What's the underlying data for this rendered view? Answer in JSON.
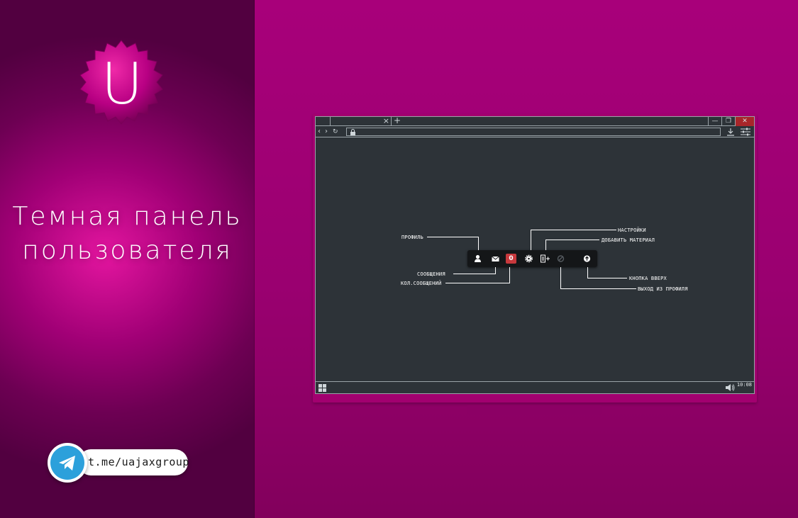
{
  "headline": {
    "line1": "Темная панель",
    "line2": "пользователя"
  },
  "badge": {
    "letter": "U"
  },
  "telegram": {
    "handle": "t.me/uajaxgroup",
    "brand_color": "#2ca0db"
  },
  "browser": {
    "tab_close": "×",
    "new_tab": "+",
    "window_buttons": {
      "minimize": "—",
      "restore": "❐",
      "close": "✕"
    },
    "nav": {
      "back": "‹",
      "forward": "›",
      "reload": "↻"
    },
    "clock": "10:08"
  },
  "user_panel": {
    "message_count": "0",
    "icons": [
      "profile-icon",
      "envelope-icon",
      "gear-icon",
      "add-material-icon",
      "logout-icon",
      "arrow-up-icon"
    ]
  },
  "annotations": {
    "profile": "ПРОФИЛЬ",
    "messages": "СООБЩЕНИЯ",
    "message_count": "КОЛ.СООБЩЕНИЙ",
    "settings": "НАСТРОЙКИ",
    "add_material": "ДОБАВИТЬ МАТЕРИАЛ",
    "scroll_up": "КНОПКА ВВЕРХ",
    "logout": "ВЫХОД ИЗ ПРОФИЛЯ"
  },
  "colors": {
    "background": "#a8007a",
    "screen": "#2d3338",
    "panel": "#141618",
    "count_badge": "#c8383c"
  }
}
